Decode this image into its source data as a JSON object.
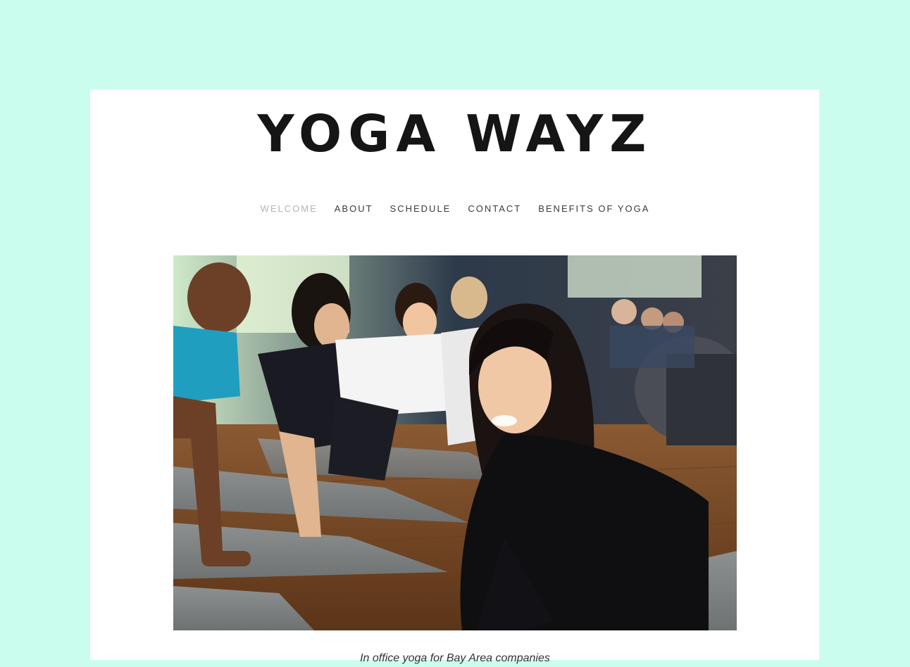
{
  "site": {
    "title": "YOGA WAYZ",
    "tagline": "In office yoga for Bay Area companies"
  },
  "nav": {
    "items": [
      {
        "label": "WELCOME",
        "active": true
      },
      {
        "label": "ABOUT",
        "active": false
      },
      {
        "label": "SCHEDULE",
        "active": false
      },
      {
        "label": "CONTACT",
        "active": false
      },
      {
        "label": "BENEFITS OF YOGA",
        "active": false
      }
    ]
  },
  "colors": {
    "background": "#cbfdef",
    "card": "#ffffff",
    "title": "#151515",
    "nav_text": "#3a3a3a",
    "nav_active": "#b3b3b3"
  },
  "hero": {
    "image_alt": "photo of people doing yoga on mats in a studio"
  }
}
